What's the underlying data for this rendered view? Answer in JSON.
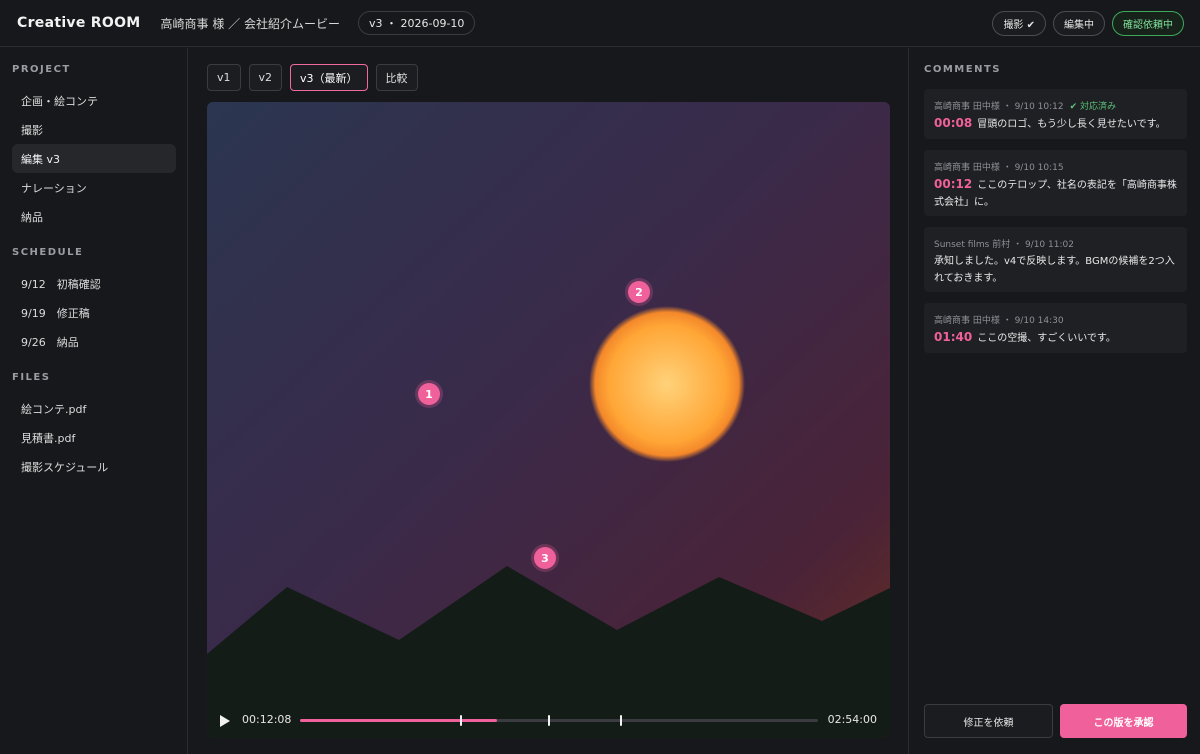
{
  "header": {
    "brand": "Creative ROOM",
    "project": "高崎商事 様 ／ 会社紹介ムービー",
    "version": "v3 ・ 2026-09-10",
    "statuses": [
      "撮影 ✔",
      "編集中",
      "確認依頼中"
    ],
    "accent_active": "#7fe09a"
  },
  "sidebar": {
    "project_title": "PROJECT",
    "project_items": [
      "企画・絵コンテ",
      "撮影",
      "編集 v3",
      "ナレーション",
      "納品"
    ],
    "schedule_title": "SCHEDULE",
    "schedule_items": [
      "9/12　初稿確認",
      "9/19　修正稿",
      "9/26　納品"
    ],
    "files_title": "FILES",
    "file_items": [
      "絵コンテ.pdf",
      "見積書.pdf",
      "撮影スケジュール"
    ]
  },
  "main": {
    "tabs": [
      "v1",
      "v2",
      "v3（最新）",
      "比較"
    ],
    "markers": [
      "1",
      "2",
      "3"
    ],
    "player": {
      "current_time": "00:12:08",
      "total_time": "02:54:00",
      "progress": 0.38,
      "comment_ticks": [
        0.31,
        0.48,
        0.62
      ]
    }
  },
  "comments": {
    "title": "COMMENTS",
    "items": [
      {
        "meta": "高崎商事 田中様 ・ 9/10 10:12",
        "resolved": "✔ 対応済み",
        "timestamp": "00:08",
        "text": "冒頭のロゴ、もう少し長く見せたいです。"
      },
      {
        "meta": "高崎商事 田中様 ・ 9/10 10:15",
        "resolved": "",
        "timestamp": "00:12",
        "text": "ここのテロップ、社名の表記を「高崎商事株式会社」に。"
      },
      {
        "meta": "Sunset films 前村 ・ 9/10 11:02",
        "resolved": "",
        "timestamp": "",
        "text": "承知しました。v4で反映します。BGMの候補を2つ入れておきます。"
      },
      {
        "meta": "高崎商事 田中様 ・ 9/10 14:30",
        "resolved": "",
        "timestamp": "01:40",
        "text": "ここの空撮、すごくいいです。"
      }
    ],
    "request_button": "修正を依頼",
    "approve_button": "この版を承認"
  },
  "colors": {
    "accent": "#f0609a",
    "background": "#17181b"
  }
}
